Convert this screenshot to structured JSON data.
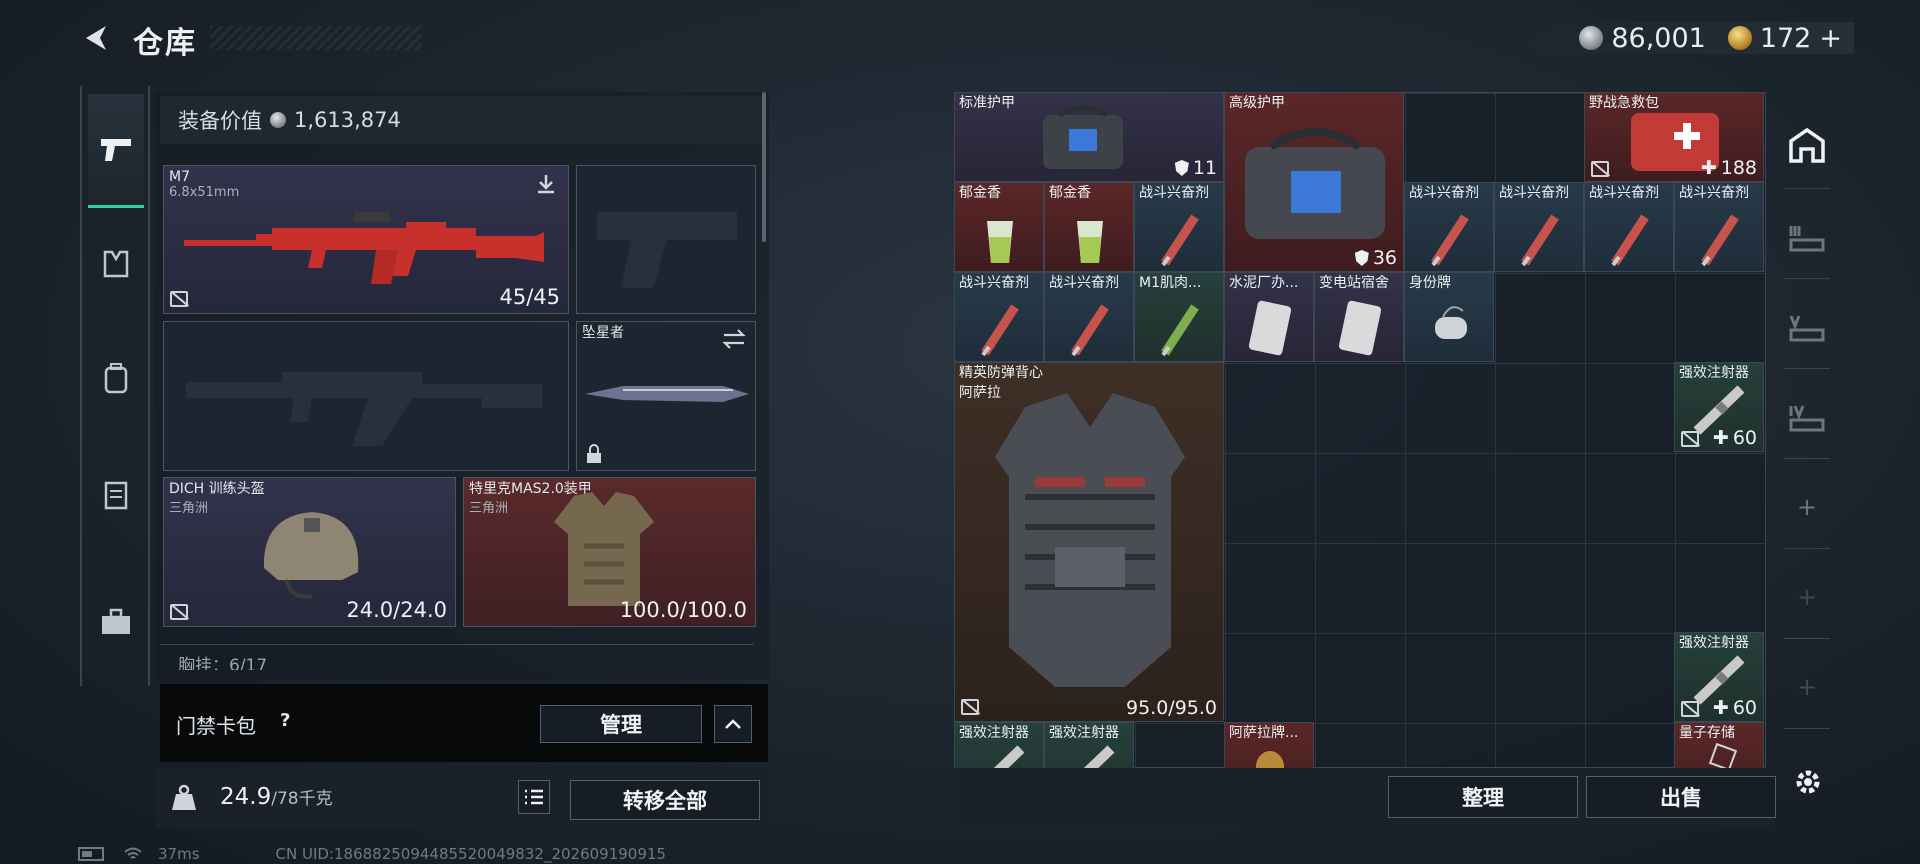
{
  "header": {
    "title": "仓库"
  },
  "currency": {
    "silver": "86,001",
    "gold": "172",
    "gold_add": "+"
  },
  "loadout": {
    "value_label": "装备价值",
    "value": "1,613,874",
    "primary": {
      "name": "M7",
      "ammo": "6.8x51mm",
      "count": "45/45"
    },
    "melee": {
      "name": "坠星者"
    },
    "helmet": {
      "name": "DICH 训练头盔",
      "sub": "三角洲",
      "durability": "24.0/24.0"
    },
    "armor": {
      "name": "特里克MAS2.0装甲",
      "sub": "三角洲",
      "durability": "100.0/100.0"
    },
    "chest_rig": "胸挂：6/17",
    "keycard_label": "门禁卡包",
    "keycard_help": "?",
    "manage_label": "管理",
    "weight_value": "24.9",
    "weight_max": "/78千克",
    "transfer_label": "转移全部"
  },
  "status": {
    "ping": "37ms",
    "uid": "CN UID:1868825094485520049832_202609190915"
  },
  "grid_items": [
    {
      "name": "标准护甲",
      "count": "11"
    },
    {
      "name": "高级护甲",
      "count": "36"
    },
    {
      "name": "野战急救包",
      "count": "188"
    },
    {
      "name": "郁金香",
      "count": ""
    },
    {
      "name": "郁金香",
      "count": ""
    },
    {
      "name": "战斗兴奋剂",
      "count": ""
    },
    {
      "name": "战斗兴奋剂",
      "count": ""
    },
    {
      "name": "战斗兴奋剂",
      "count": ""
    },
    {
      "name": "战斗兴奋剂",
      "count": ""
    },
    {
      "name": "战斗兴奋剂",
      "count": ""
    },
    {
      "name": "战斗兴奋剂",
      "count": ""
    },
    {
      "name": "战斗兴奋剂",
      "count": ""
    },
    {
      "name": "M1肌肉...",
      "count": ""
    },
    {
      "name": "水泥厂办...",
      "count": ""
    },
    {
      "name": "变电站宿舍",
      "count": ""
    },
    {
      "name": "身份牌",
      "count": ""
    },
    {
      "name": "精英防弹背心",
      "sub": "阿萨拉",
      "count": "95.0/95.0"
    },
    {
      "name": "强效注射器",
      "count": "60"
    },
    {
      "name": "强效注射器",
      "count": "60"
    },
    {
      "name": "强效注射器",
      "count": ""
    },
    {
      "name": "强效注射器",
      "count": ""
    },
    {
      "name": "阿萨拉牌...",
      "count": ""
    },
    {
      "name": "量子存储",
      "count": ""
    }
  ],
  "actions": {
    "sort": "整理",
    "sell": "出售"
  },
  "right_nav": {
    "plus1": "+",
    "plus2": "+",
    "plus3": "+"
  }
}
